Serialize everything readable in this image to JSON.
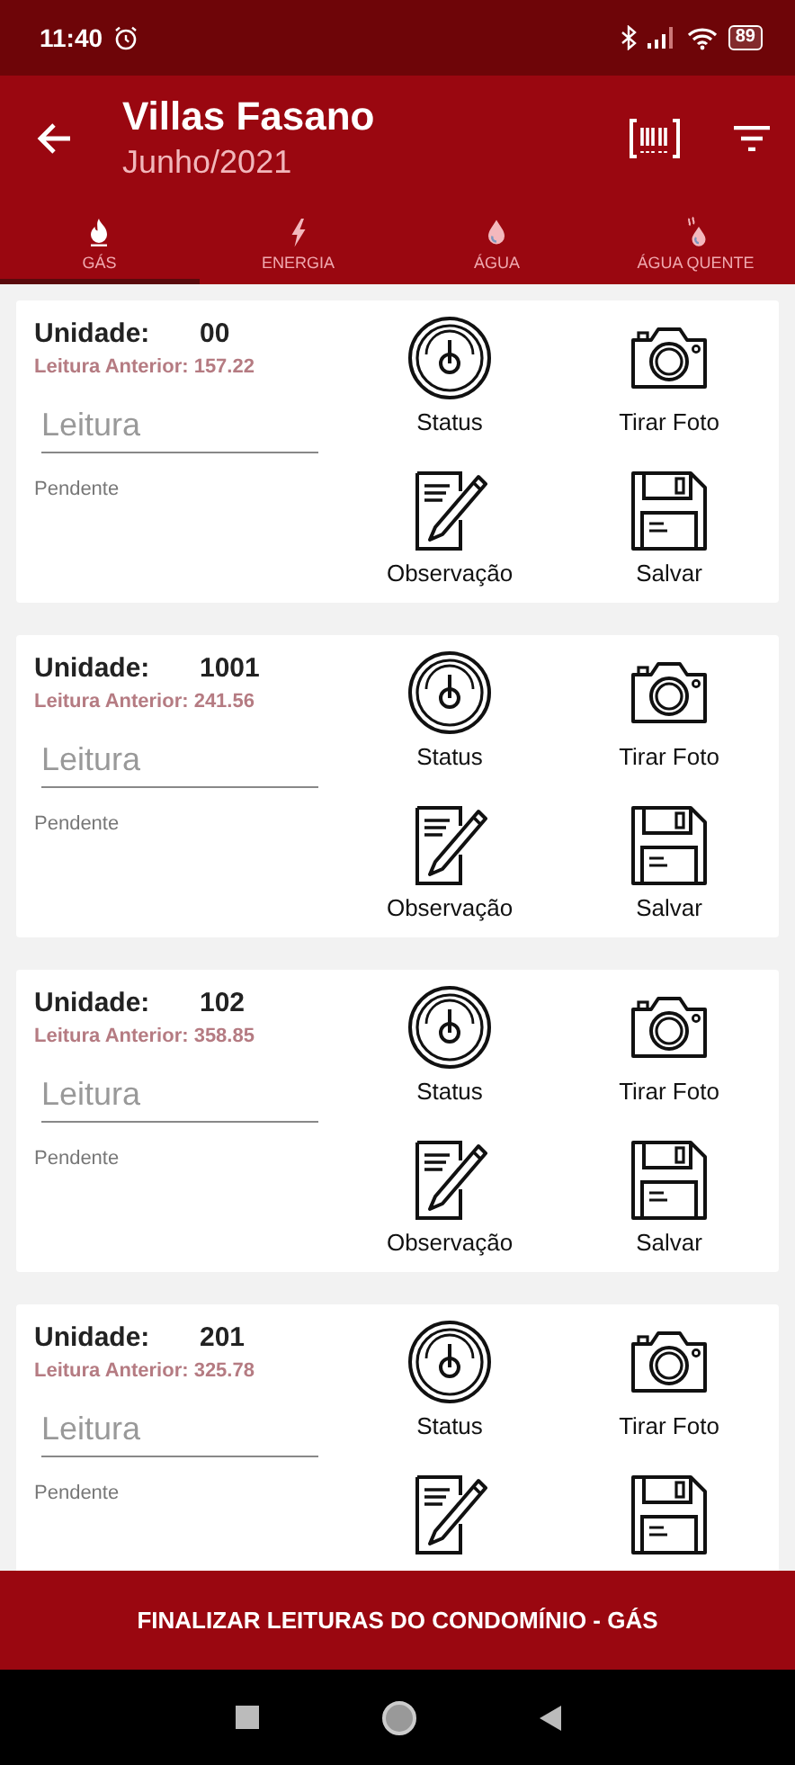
{
  "status_bar": {
    "time": "11:40",
    "battery": "89"
  },
  "header": {
    "title": "Villas Fasano",
    "subtitle": "Junho/2021"
  },
  "tabs": [
    {
      "kind": "gas",
      "label": "GÁS",
      "selected": true
    },
    {
      "kind": "energy",
      "label": "ENERGIA",
      "selected": false
    },
    {
      "kind": "water",
      "label": "ÁGUA",
      "selected": false
    },
    {
      "kind": "hot_water",
      "label": "ÁGUA QUENTE",
      "selected": false
    }
  ],
  "cards": [
    {
      "unit_label": "Unidade:",
      "unit": "00",
      "previous": "Leitura Anterior: 157.22",
      "reading": {
        "placeholder": "Leitura"
      },
      "status": "Pendente",
      "actions": [
        {
          "kind": "status",
          "label": "Status"
        },
        {
          "kind": "photo",
          "label": "Tirar Foto"
        },
        {
          "kind": "note",
          "label": "Observação"
        },
        {
          "kind": "save",
          "label": "Salvar"
        }
      ]
    },
    {
      "unit_label": "Unidade:",
      "unit": "1001",
      "previous": "Leitura Anterior: 241.56",
      "reading": {
        "placeholder": "Leitura"
      },
      "status": "Pendente",
      "actions": [
        {
          "kind": "status",
          "label": "Status"
        },
        {
          "kind": "photo",
          "label": "Tirar Foto"
        },
        {
          "kind": "note",
          "label": "Observação"
        },
        {
          "kind": "save",
          "label": "Salvar"
        }
      ]
    },
    {
      "unit_label": "Unidade:",
      "unit": "102",
      "previous": "Leitura Anterior: 358.85",
      "reading": {
        "placeholder": "Leitura"
      },
      "status": "Pendente",
      "actions": [
        {
          "kind": "status",
          "label": "Status"
        },
        {
          "kind": "photo",
          "label": "Tirar Foto"
        },
        {
          "kind": "note",
          "label": "Observação"
        },
        {
          "kind": "save",
          "label": "Salvar"
        }
      ]
    },
    {
      "unit_label": "Unidade:",
      "unit": "201",
      "previous": "Leitura Anterior: 325.78",
      "reading": {
        "placeholder": "Leitura"
      },
      "status": "Pendente",
      "actions": [
        {
          "kind": "status",
          "label": "Status"
        },
        {
          "kind": "photo",
          "label": "Tirar Foto"
        },
        {
          "kind": "note"
        },
        {
          "kind": "save"
        }
      ]
    }
  ],
  "finish_button": "FINALIZAR LEITURAS DO CONDOMÍNIO - GÁS"
}
